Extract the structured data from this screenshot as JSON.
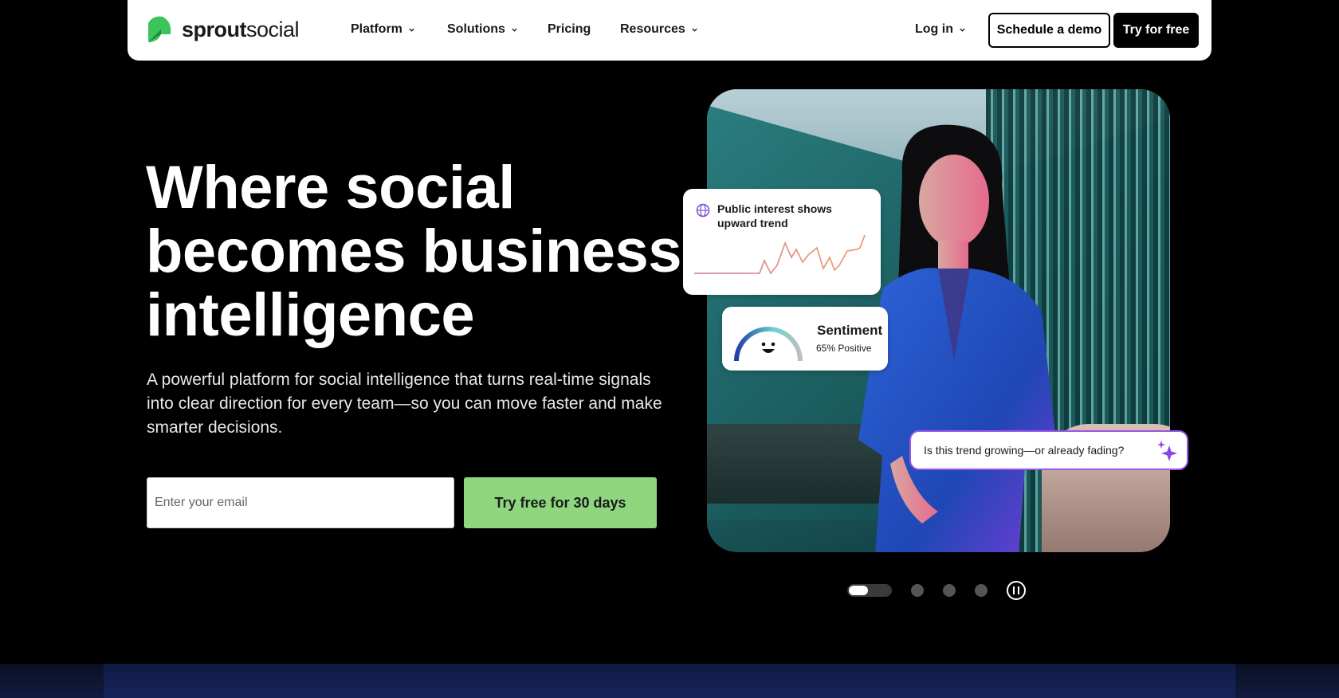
{
  "brand": {
    "name_bold": "sprout",
    "name_regular": "social",
    "logo_color": "#3bc45a"
  },
  "nav": {
    "items": [
      {
        "label": "Platform",
        "has_dropdown": true
      },
      {
        "label": "Solutions",
        "has_dropdown": true
      },
      {
        "label": "Pricing",
        "has_dropdown": false
      },
      {
        "label": "Resources",
        "has_dropdown": true
      }
    ],
    "login": "Log in",
    "demo": "Schedule a demo",
    "try": "Try for free"
  },
  "hero": {
    "headline": "Where social becomes business intelligence",
    "subtext": "A powerful platform for social intelligence that turns real-time signals into clear direction for every team—so you can move faster and make smarter decisions.",
    "email_placeholder": "Enter your email",
    "cta": "Try free for 30 days",
    "cta_color": "#8fd77f"
  },
  "cards": {
    "trend": {
      "title": "Public interest shows upward trend",
      "icon": "globe-icon"
    },
    "sentiment": {
      "title": "Sentiment",
      "detail": "65% Positive",
      "percent": 65
    },
    "ask": {
      "question": "Is this trend growing—or already fading?",
      "icon": "sparkle-icon",
      "border_color": "#9b55e8"
    }
  },
  "carousel": {
    "slides": 4,
    "active": 1
  }
}
